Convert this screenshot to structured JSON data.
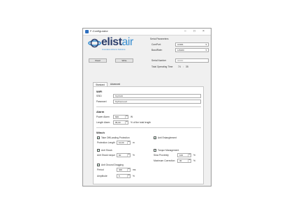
{
  "window": {
    "title": "F-Configurator",
    "controls": [
      "–",
      "□",
      "×"
    ]
  },
  "logo": {
    "part1": "elist",
    "part2": "air",
    "tagline": "Innovative Airborne Solutions"
  },
  "serial_params": {
    "heading": "Serial Parameters",
    "comport_label": "ComPort:",
    "comport_value": "COM1",
    "baud_label": "BaudRate:",
    "baud_value": "115200"
  },
  "buttons": {
    "read": "Read",
    "write": "Write"
  },
  "serial_number": {
    "label": "Serial Number",
    "placeholder": "00000"
  },
  "operating_time": {
    "label": "Total Operating Time",
    "hours": "74",
    "separator": ":",
    "minutes": "35"
  },
  "tabs": [
    {
      "label": "Standard"
    },
    {
      "label": "Advanced"
    }
  ],
  "wifi": {
    "heading": "WiFi",
    "ssid_label": "SSID",
    "ssid_value": "MySSID",
    "password_label": "Password",
    "password_value": "MyPassword"
  },
  "alarm": {
    "heading": "Alarm",
    "power_label": "Power Alarm",
    "power_value": "600",
    "power_unit": "W",
    "length_label": "Length Alarm",
    "length_value": "95,00",
    "length_unit": "% of the total length"
  },
  "winch": {
    "heading": "Winch",
    "take_off_label": "Take Off/Landing Protection",
    "protection_length_label": "Protection Length",
    "protection_length_value": "10,00",
    "protection_length_unit": "m",
    "anti_entanglement_label": "Anti Entanglement",
    "anti_shock_label": "Anti Shock",
    "anti_shock_torque_label": "Anti Shock torque",
    "anti_shock_torque_value": "60",
    "anti_shock_torque_unit": "%",
    "torque_label": "Torque Management",
    "slow_proximity_label": "Slow Proximity",
    "slow_proximity_value": "100",
    "slow_proximity_unit": "%",
    "max_correction_label": "Maximum Correction",
    "max_correction_value": "30",
    "max_correction_unit": "%",
    "anti_ground_label": "Anti Ground Dragging",
    "period_label": "Period",
    "period_value": "400",
    "period_unit": "ms",
    "amplitude_label": "Amplitude",
    "amplitude_value": "5",
    "amplitude_unit": "%"
  },
  "colors": {
    "brand_dark": "#2c3e6b",
    "brand_light": "#3a8fd1"
  }
}
